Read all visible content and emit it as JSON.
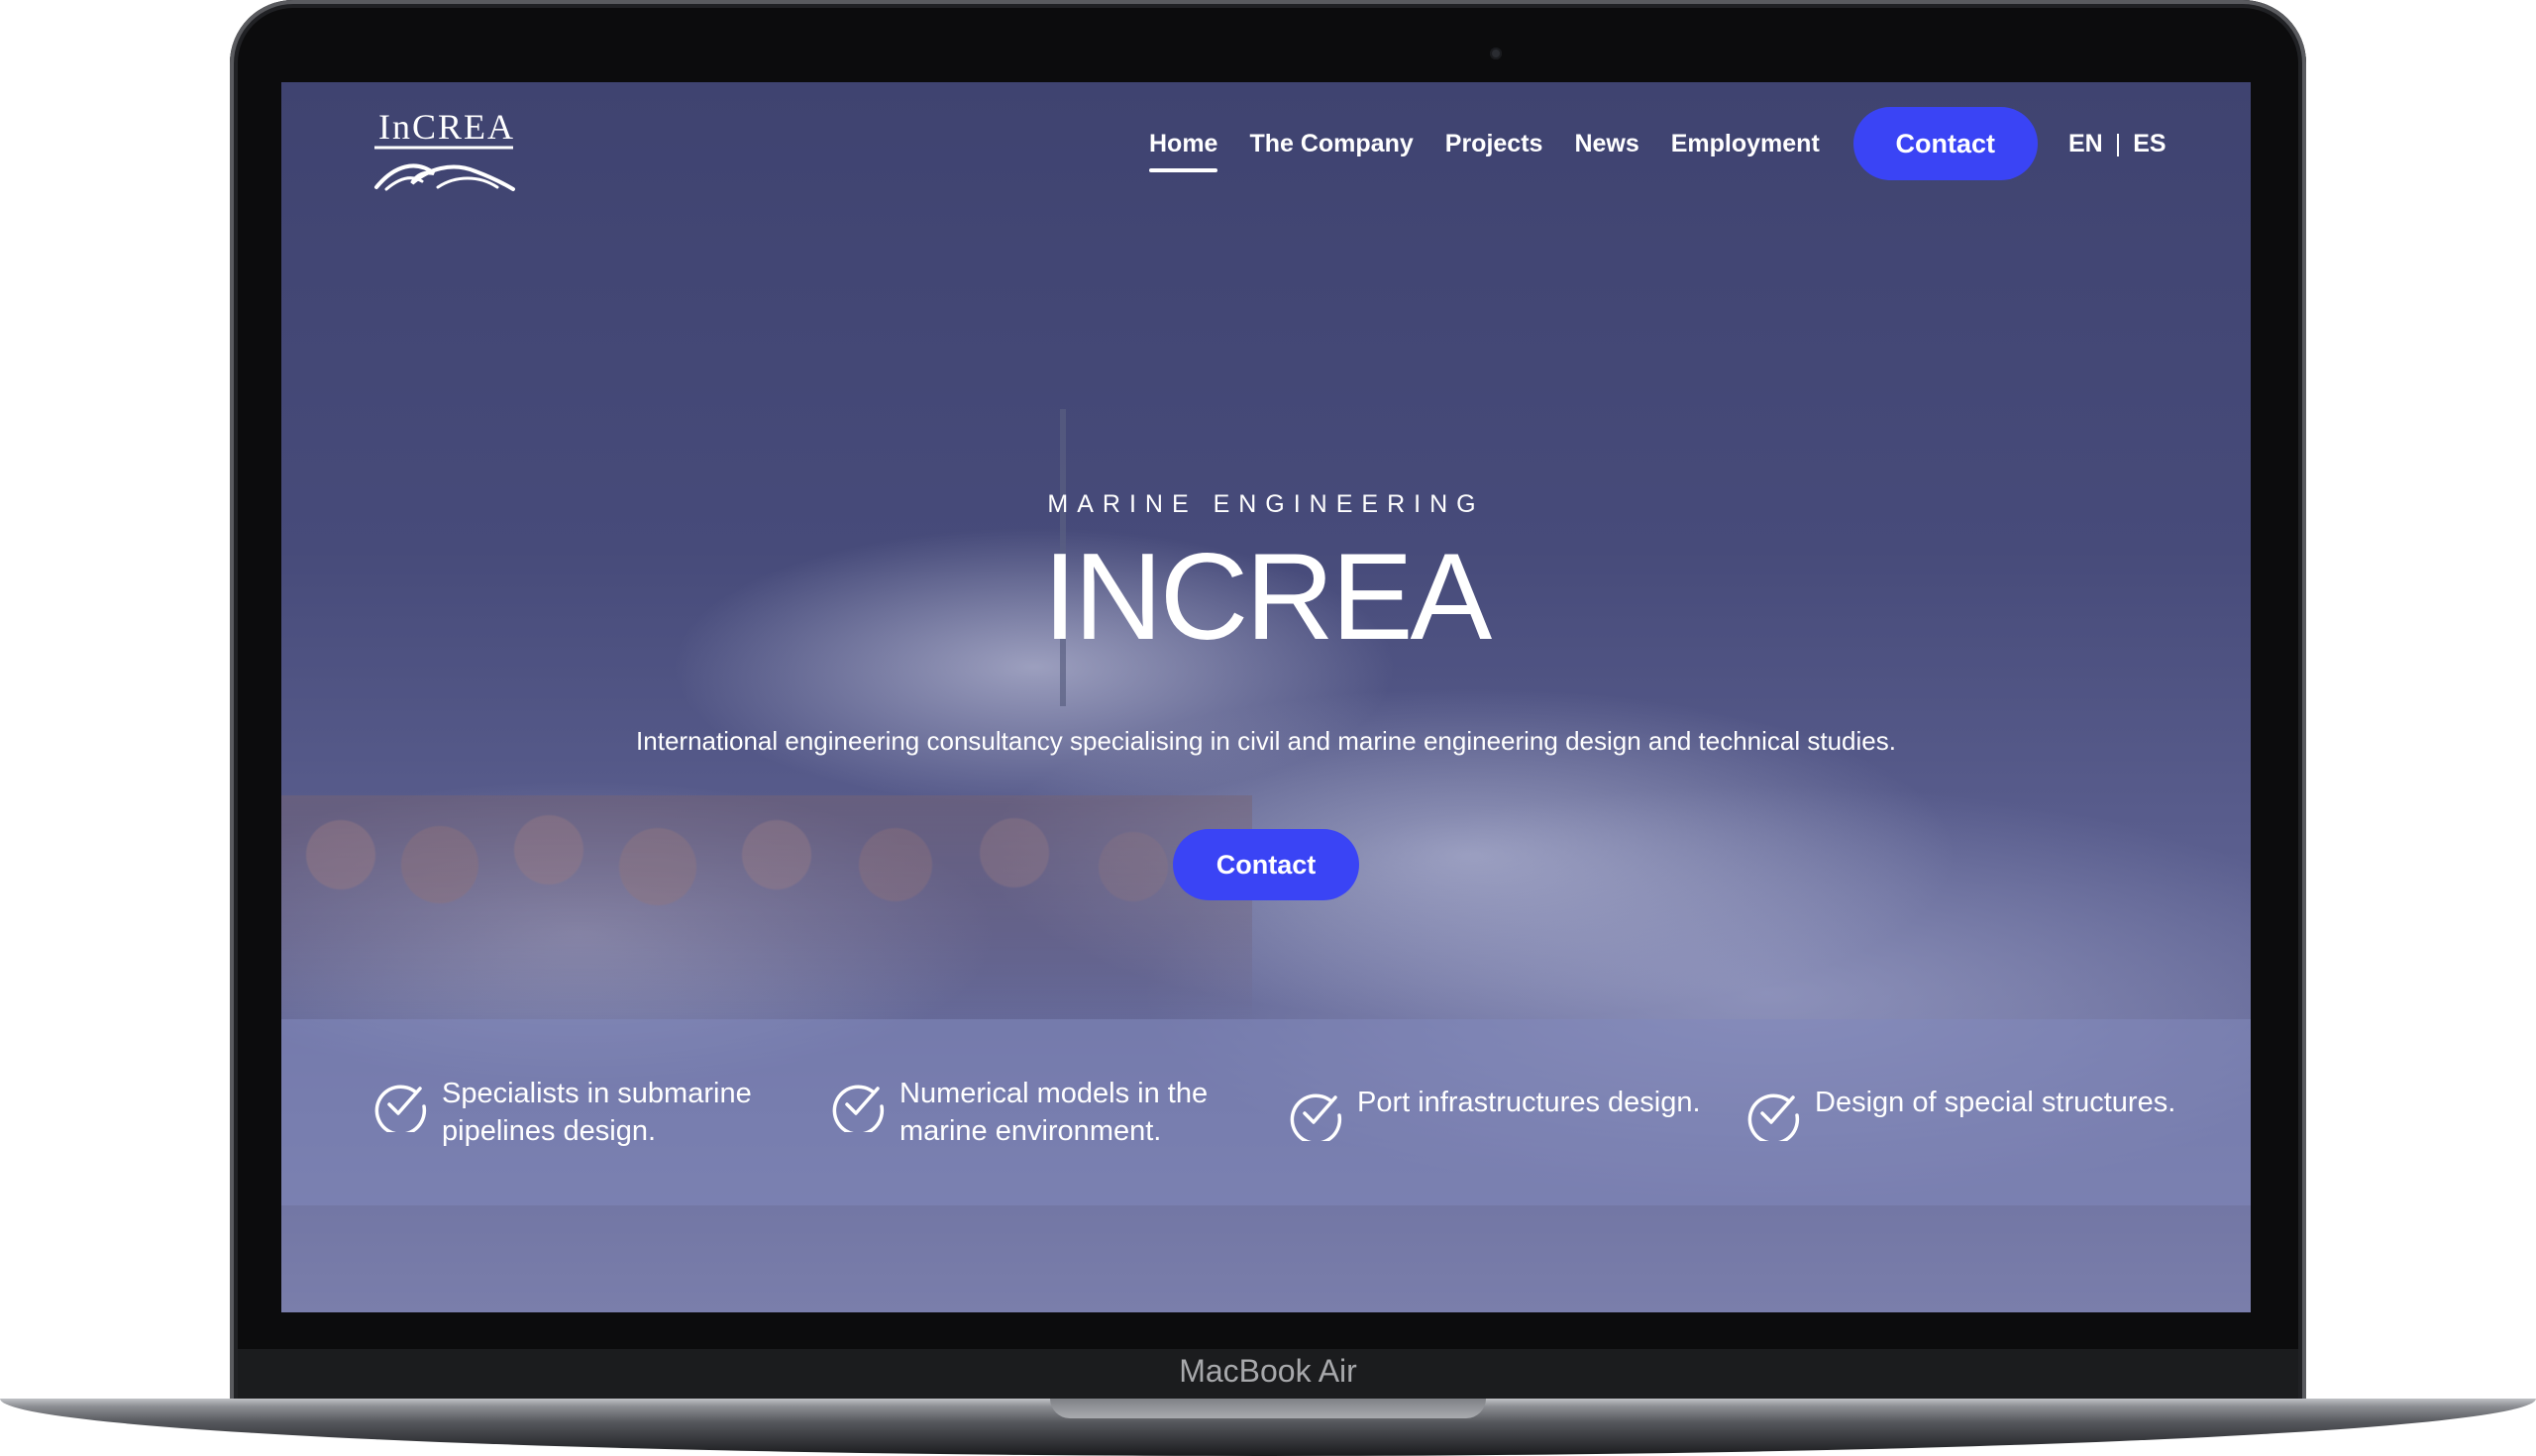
{
  "device": {
    "model_label": "MacBook Air"
  },
  "header": {
    "logo_text": "InCREA",
    "nav": [
      {
        "label": "Home",
        "active": true
      },
      {
        "label": "The Company",
        "active": false
      },
      {
        "label": "Projects",
        "active": false
      },
      {
        "label": "News",
        "active": false
      },
      {
        "label": "Employment",
        "active": false
      }
    ],
    "contact_button": "Contact",
    "languages": {
      "en": "EN",
      "separator": "|",
      "es": "ES"
    }
  },
  "hero": {
    "eyebrow": "MARINE ENGINEERING",
    "title": "INCREA",
    "subtitle": "International engineering consultancy specialising in civil and marine engineering design and technical studies.",
    "contact_button": "Contact"
  },
  "features": [
    {
      "icon": "check-circle-icon",
      "text": "Specialists in submarine pipelines design."
    },
    {
      "icon": "check-circle-icon",
      "text": "Numerical models in the marine environment."
    },
    {
      "icon": "check-circle-icon",
      "text": "Port infrastructures design."
    },
    {
      "icon": "check-circle-icon",
      "text": "Design of special structures."
    }
  ],
  "colors": {
    "accent": "#3a44f5",
    "overlay": "#4b4f7a",
    "text": "#ffffff"
  }
}
